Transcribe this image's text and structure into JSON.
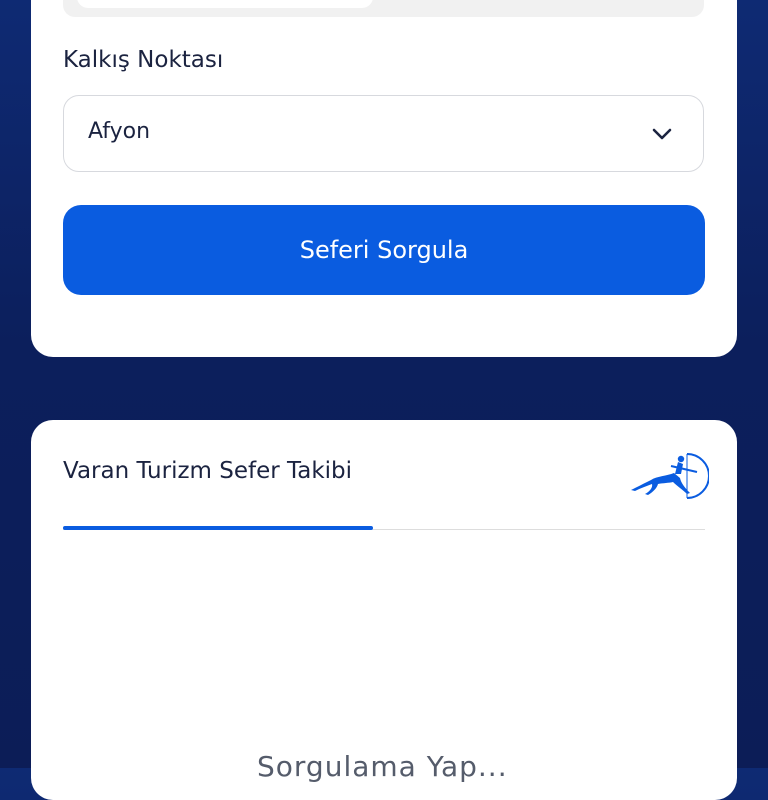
{
  "query_card": {
    "departure_label": "Kalkış Noktası",
    "departure_value": "Afyon",
    "submit_label": "Seferi Sorgula"
  },
  "tracking_card": {
    "title": "Varan Turizm Sefer Takibi",
    "partial_bottom_text": "Sorgulama Yap..."
  },
  "colors": {
    "background": "#0c1f5c",
    "accent": "#0a5ce0",
    "text": "#1b2340"
  },
  "icons": {
    "dropdown": "chevron-down-icon",
    "logo": "archer-centaur-logo"
  }
}
